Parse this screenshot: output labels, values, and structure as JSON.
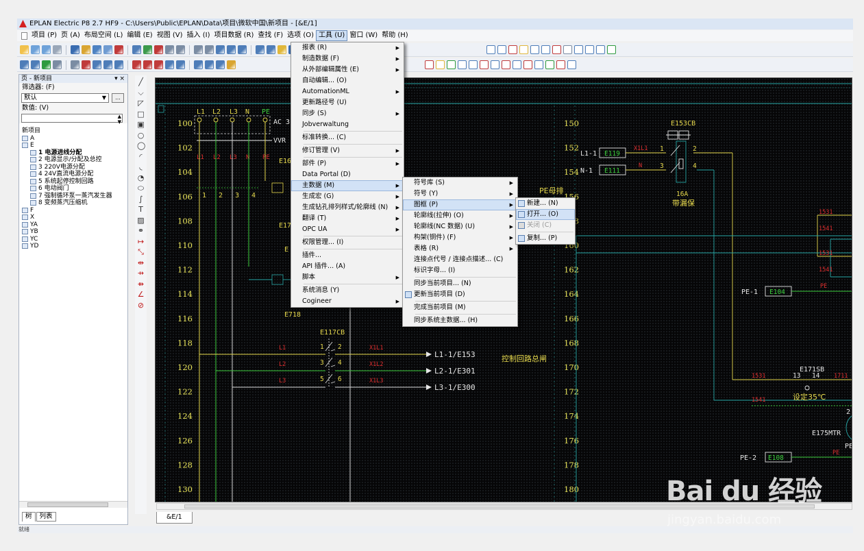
{
  "title_bar": {
    "text": "EPLAN Electric P8 2.7 HF9 - C:\\Users\\Public\\EPLAN\\Data\\项目\\微软中国\\新项目 - [&E/1]"
  },
  "menubar": {
    "items": [
      "项目 (P)",
      "页 (A)",
      "布局空间 (L)",
      "编辑 (E)",
      "视图 (V)",
      "插入 (I)",
      "项目数据 (R)",
      "查找 (F)",
      "选项 (O)",
      "工具 (U)",
      "窗口 (W)",
      "帮助 (H)"
    ],
    "active": "工具 (U)"
  },
  "left_panel": {
    "title": "页 - 新项目",
    "title_buttons": "▾ ×",
    "filter_label": "筛选器: (F)",
    "filter_value": "默认",
    "filter_more": "...",
    "value_label": "数值: (V)",
    "value_input": "",
    "tree": [
      {
        "label": "新项目",
        "level": 0,
        "icon": false
      },
      {
        "label": "A",
        "level": 1,
        "icon": true
      },
      {
        "label": "E",
        "level": 1,
        "icon": true
      },
      {
        "label": "1 电源进线分配",
        "level": 2,
        "icon": true,
        "bold": true
      },
      {
        "label": "2 电源显示/分配及总控",
        "level": 2,
        "icon": true
      },
      {
        "label": "3 220V电源分配",
        "level": 2,
        "icon": true
      },
      {
        "label": "4 24V直流电源分配",
        "level": 2,
        "icon": true
      },
      {
        "label": "5 系统起停控制回路",
        "level": 2,
        "icon": true
      },
      {
        "label": "6 电动阀门",
        "level": 2,
        "icon": true
      },
      {
        "label": "7 强制循环泵一蒸汽发生器",
        "level": 2,
        "icon": true
      },
      {
        "label": "8 变频蒸汽压缩机",
        "level": 2,
        "icon": true
      },
      {
        "label": "F",
        "level": 1,
        "icon": true
      },
      {
        "label": "X",
        "level": 1,
        "icon": true
      },
      {
        "label": "YA",
        "level": 1,
        "icon": true
      },
      {
        "label": "YB",
        "level": 1,
        "icon": true
      },
      {
        "label": "YC",
        "level": 1,
        "icon": true
      },
      {
        "label": "YD",
        "level": 1,
        "icon": true
      }
    ],
    "tabs": [
      "树",
      "列表"
    ]
  },
  "tools_menu": {
    "items": [
      {
        "label": "报表 (R)",
        "submenu": true
      },
      {
        "label": "制造数据 (F)",
        "submenu": true
      },
      {
        "label": "从外部编辑属性 (E)",
        "submenu": true
      },
      {
        "label": "自动编辑... (O)"
      },
      {
        "label": "AutomationML",
        "submenu": true
      },
      {
        "label": "更新路径号 (U)"
      },
      {
        "label": "同步 (S)",
        "submenu": true
      },
      {
        "label": "Jobverwaltung"
      },
      {
        "sep": true
      },
      {
        "label": "标准转换... (C)"
      },
      {
        "sep": true
      },
      {
        "label": "修订管理 (V)",
        "submenu": true
      },
      {
        "sep": true
      },
      {
        "label": "部件 (P)",
        "submenu": true
      },
      {
        "label": "Data Portal (D)"
      },
      {
        "label": "主数据 (M)",
        "submenu": true,
        "highlight": true
      },
      {
        "label": "生成宏 (G)",
        "submenu": true
      },
      {
        "label": "生成钻孔排列样式/轮廓线 (N)",
        "submenu": true
      },
      {
        "label": "翻译 (T)",
        "submenu": true
      },
      {
        "label": "OPC UA",
        "submenu": true
      },
      {
        "sep": true
      },
      {
        "label": "权限管理... (I)"
      },
      {
        "sep": true
      },
      {
        "label": "插件..."
      },
      {
        "label": "API 插件... (A)"
      },
      {
        "label": "脚本",
        "submenu": true
      },
      {
        "sep": true
      },
      {
        "label": "系统消息 (Y)"
      },
      {
        "label": "Cogineer",
        "submenu": true
      }
    ]
  },
  "master_data_menu": {
    "items": [
      {
        "label": "符号库 (S)",
        "submenu": true
      },
      {
        "label": "符号 (Y)",
        "submenu": true
      },
      {
        "label": "图框 (P)",
        "submenu": true,
        "highlight": true
      },
      {
        "label": "轮廓线(拉伸) (O)",
        "submenu": true
      },
      {
        "label": "轮廓线(NC 数据) (U)",
        "submenu": true
      },
      {
        "label": "构架(铜件) (F)",
        "submenu": true
      },
      {
        "label": "表格 (R)",
        "submenu": true
      },
      {
        "label": "连接点代号 / 连接点描述... (C)"
      },
      {
        "label": "标识字母... (I)"
      },
      {
        "sep": true
      },
      {
        "label": "同步当前项目... (N)"
      },
      {
        "label": "更新当前项目 (D)",
        "icon": true
      },
      {
        "sep": true
      },
      {
        "label": "完成当前项目 (M)"
      },
      {
        "sep": true
      },
      {
        "label": "同步系统主数据... (H)"
      }
    ]
  },
  "frame_menu": {
    "items": [
      {
        "label": "新建... (N)",
        "icon": true
      },
      {
        "label": "打开... (O)",
        "icon": true,
        "highlight": true
      },
      {
        "label": "关闭 (C)",
        "icon": true,
        "disabled": true
      },
      {
        "sep": true
      },
      {
        "label": "复制... (P)",
        "icon": true
      }
    ]
  },
  "schematic": {
    "row_numbers_left": [
      "100",
      "102",
      "104",
      "106",
      "108",
      "110",
      "112",
      "114",
      "116",
      "118",
      "120",
      "122",
      "124",
      "126",
      "128",
      "130"
    ],
    "row_numbers_right": [
      "150",
      "152",
      "154",
      "156",
      "158",
      "160",
      "162",
      "164",
      "166",
      "168",
      "170",
      "172",
      "174",
      "176",
      "178",
      "180"
    ],
    "phase_labels": [
      "L1",
      "L2",
      "L3",
      "N",
      "PE"
    ],
    "ac_label": "AC 3",
    "wvr_label": "VVR",
    "bus_numbers": [
      "1",
      "2",
      "3",
      "4"
    ],
    "e_labels": [
      "E16",
      "E17",
      "E",
      "E718"
    ],
    "breaker_main": "E117CB",
    "breaker_main_pins": [
      "1",
      "2",
      "3",
      "4",
      "5",
      "6"
    ],
    "outputs": [
      "L1-1/E153",
      "L2-1/E301",
      "L3-1/E300"
    ],
    "control_label": "控制回路总闸",
    "pe_bus_label": "PE母排",
    "right_terminals": {
      "l1": "L1-1",
      "n1": "N-1",
      "e119": "E119",
      "e111": "E111",
      "pe1": "PE-1",
      "e104": "E104",
      "pe2": "PE-2",
      "e108": "E108"
    },
    "rcbo": {
      "name": "E153CB",
      "rating": "16A",
      "desc": "带漏保",
      "pins": [
        "1",
        "2",
        "3",
        "4"
      ]
    },
    "e171": {
      "name": "E171SB",
      "pins": [
        "13",
        "14"
      ],
      "desc": "设定35℃"
    },
    "e175": "E175MTR",
    "pe_right": "PE",
    "two_label": "2"
  },
  "canvas_tabs": [
    "&E/1"
  ],
  "status_text": "就绪",
  "watermark": {
    "text": "Bai du 经验",
    "url": "jingyan.baidu.com"
  }
}
